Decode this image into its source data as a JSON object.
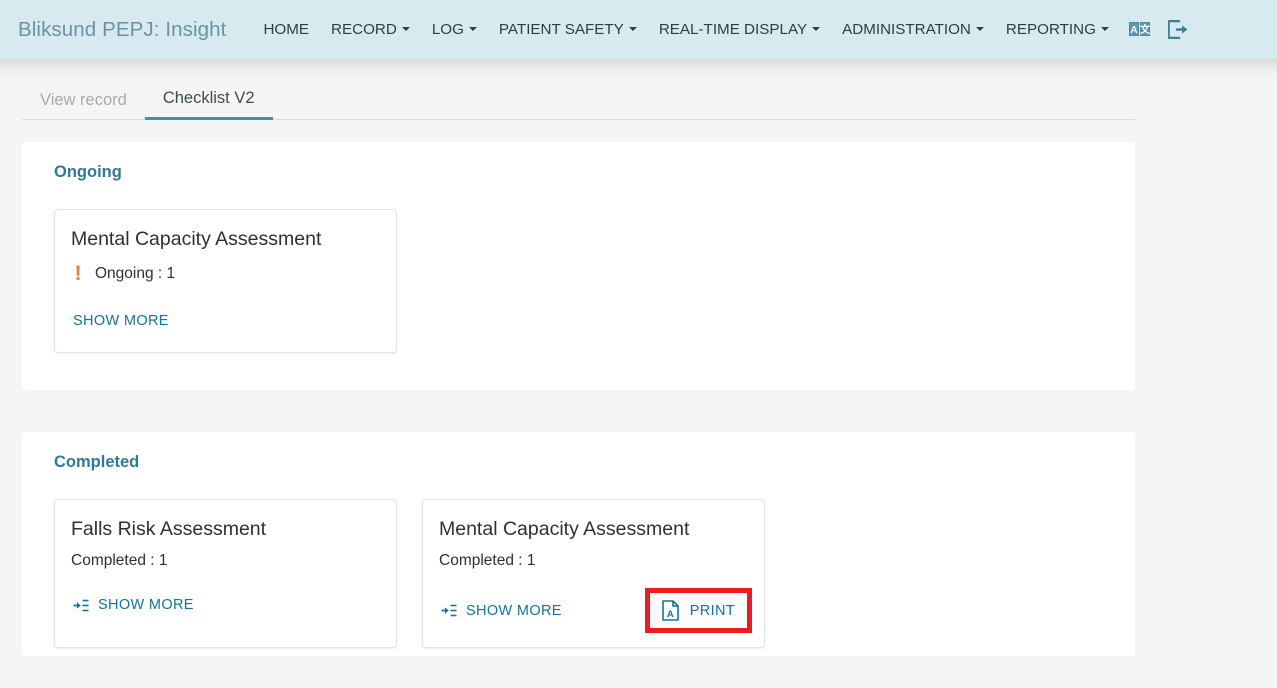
{
  "navbar": {
    "brand": "Bliksund PEPJ: Insight",
    "background_color": "#d7eaef",
    "brand_color": "#6a93a3",
    "items": [
      {
        "label": "HOME",
        "has_caret": false
      },
      {
        "label": "RECORD",
        "has_caret": true
      },
      {
        "label": "LOG",
        "has_caret": true
      },
      {
        "label": "PATIENT SAFETY",
        "has_caret": true
      },
      {
        "label": "REAL-TIME DISPLAY",
        "has_caret": true
      },
      {
        "label": "ADMINISTRATION",
        "has_caret": true
      },
      {
        "label": "REPORTING",
        "has_caret": true
      }
    ],
    "icons": [
      {
        "name": "translate-icon"
      },
      {
        "name": "sign-out-icon"
      }
    ]
  },
  "tabs": [
    {
      "label": "View record",
      "active": false
    },
    {
      "label": "Checklist V2",
      "active": true
    }
  ],
  "sections": [
    {
      "title": "Ongoing",
      "cards": [
        {
          "title": "Mental Capacity Assessment",
          "status_label": "Ongoing : 1",
          "status_icon": "exclamation-icon",
          "status_icon_color": "#f57c20",
          "show_more_label": "SHOW MORE",
          "show_more_icon": null,
          "print_label": null,
          "highlighted": false
        }
      ]
    },
    {
      "title": "Completed",
      "cards": [
        {
          "title": "Falls Risk Assessment",
          "status_label": "Completed : 1",
          "status_icon": null,
          "status_icon_color": null,
          "show_more_label": "SHOW MORE",
          "show_more_icon": "indent-icon",
          "print_label": null,
          "highlighted": false
        },
        {
          "title": "Mental Capacity Assessment",
          "status_label": "Completed : 1",
          "status_icon": null,
          "status_icon_color": null,
          "show_more_label": "SHOW MORE",
          "show_more_icon": "indent-icon",
          "print_label": "PRINT",
          "print_icon": "pdf-file-icon",
          "highlighted": true,
          "highlight_color": "#ee1b22"
        }
      ]
    }
  ],
  "theme": {
    "link_color": "#15739b",
    "section_title_color": "#31789a",
    "tab_active_underline": "#4d8ba3",
    "page_background": "#f5f5f5"
  }
}
